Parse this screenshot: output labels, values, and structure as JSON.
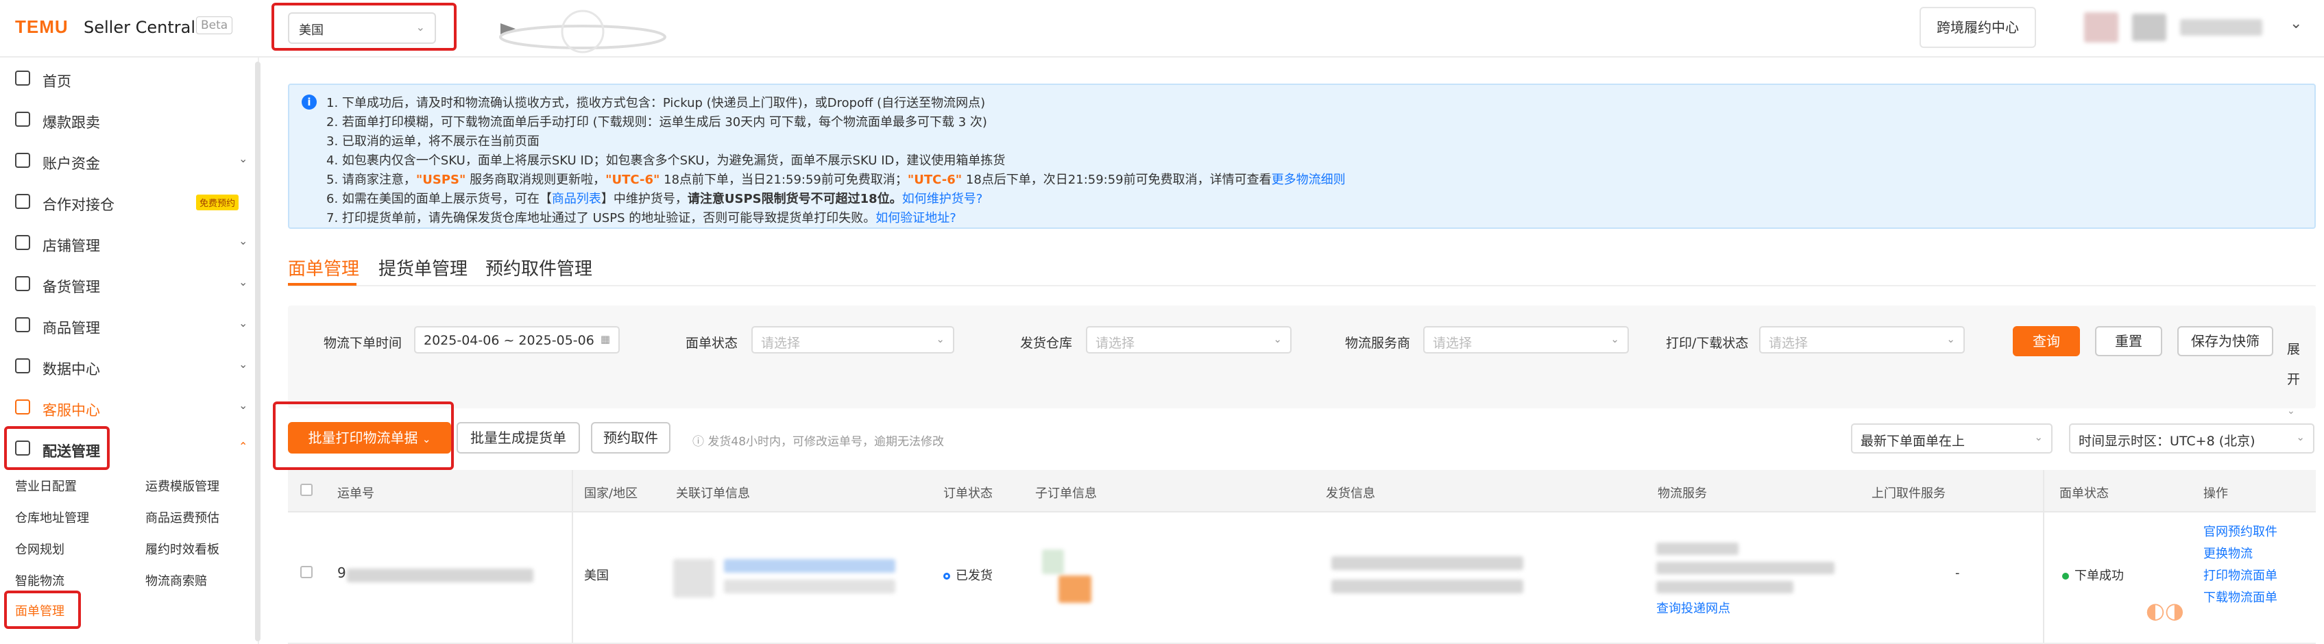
{
  "header": {
    "logo": "TEMU",
    "brand": "Seller Central",
    "beta": "Beta",
    "region": "美国",
    "cross_border_center": "跨境履约中心"
  },
  "sidebar": {
    "items": [
      {
        "label": "首页",
        "icon": "home-icon"
      },
      {
        "label": "爆款跟卖",
        "icon": "cart-icon"
      },
      {
        "label": "账户资金",
        "icon": "wallet-icon"
      },
      {
        "label": "合作对接仓",
        "icon": "warehouse-icon",
        "tag": "免费预约"
      },
      {
        "label": "店铺管理",
        "icon": "store-icon"
      },
      {
        "label": "备货管理",
        "icon": "stock-icon"
      },
      {
        "label": "商品管理",
        "icon": "product-icon"
      },
      {
        "label": "数据中心",
        "icon": "data-icon"
      },
      {
        "label": "客服中心",
        "icon": "service-icon"
      },
      {
        "label": "配送管理",
        "icon": "delivery-icon"
      }
    ],
    "sub_items": [
      "营业日配置",
      "运费模版管理",
      "仓库地址管理",
      "商品运费预估",
      "仓网规划",
      "履约时效看板",
      "智能物流",
      "物流商索赔",
      "面单管理"
    ]
  },
  "notice": {
    "lines": [
      "1. 下单成功后，请及时和物流确认揽收方式，揽收方式包含：Pickup (快递员上门取件)，或Dropoff (自行送至物流网点)",
      "2. 若面单打印模糊，可下载物流面单后手动打印 (下载规则：运单生成后 30天内 可下载，每个物流面单最多可下载 3 次)",
      "3. 已取消的运单，将不展示在当前页面",
      "4. 如包裹内仅含一个SKU，面单上将展示SKU ID；如包裹含多个SKU，为避免漏货，面单不展示SKU ID，建议使用箱单拣货"
    ],
    "line5": {
      "a": "5. 请商家注意，",
      "b": "\"USPS\"",
      "c": " 服务商取消规则更新啦，",
      "d": "\"UTC-6\"",
      "e": " 18点前下单，当日21:59:59前可免费取消；",
      "f": "\"UTC-6\"",
      "g": " 18点后下单，次日21:59:59前可免费取消，详情可查看",
      "h": "更多物流细则"
    },
    "line6": {
      "a": "6. 如需在美国的面单上展示货号，可在【",
      "b": "商品列表",
      "c": "】中维护货号，",
      "d": "请注意USPS限制货号不可超过18位。",
      "e": "如何维护货号?"
    },
    "line7": {
      "a": "7. 打印提货单前，请先确保发货仓库地址通过了 USPS 的地址验证，否则可能导致提货单打印失败。",
      "b": "如何验证地址?"
    }
  },
  "tabs": [
    "面单管理",
    "提货单管理",
    "预约取件管理"
  ],
  "filters": {
    "order_time_label": "物流下单时间",
    "order_time_value": "2025-04-06 ~ 2025-05-06",
    "status_label": "面单状态",
    "warehouse_label": "发货仓库",
    "carrier_label": "物流服务商",
    "print_label": "打印/下载状态",
    "placeholder": "请选择",
    "query": "查询",
    "reset": "重置",
    "save": "保存为快筛",
    "expand": "展开"
  },
  "actions": {
    "batch_print": "批量打印物流单据",
    "batch_pickup": "批量生成提货单",
    "book_pickup": "预约取件",
    "hint": "ⓘ 发货48小时内，可修改运单号，逾期无法修改",
    "sort": "最新下单面单在上",
    "timezone": "时间显示时区：UTC+8 (北京)"
  },
  "table": {
    "headers": [
      "运单号",
      "国家/地区",
      "关联订单信息",
      "订单状态",
      "子订单信息",
      "发货信息",
      "物流服务",
      "上门取件服务",
      "面单状态",
      "操作"
    ],
    "row": {
      "waybill": "9",
      "country": "美国",
      "order_status": "已发货",
      "carrier_link": "查询投递网点",
      "pickup_service": "-",
      "label_status": "下单成功",
      "ops": [
        "官网预约取件",
        "更换物流",
        "打印物流面单",
        "下载物流面单"
      ]
    }
  },
  "colors": {
    "accent": "#fb6d10",
    "link": "#1677ff",
    "success": "#22b14c"
  }
}
